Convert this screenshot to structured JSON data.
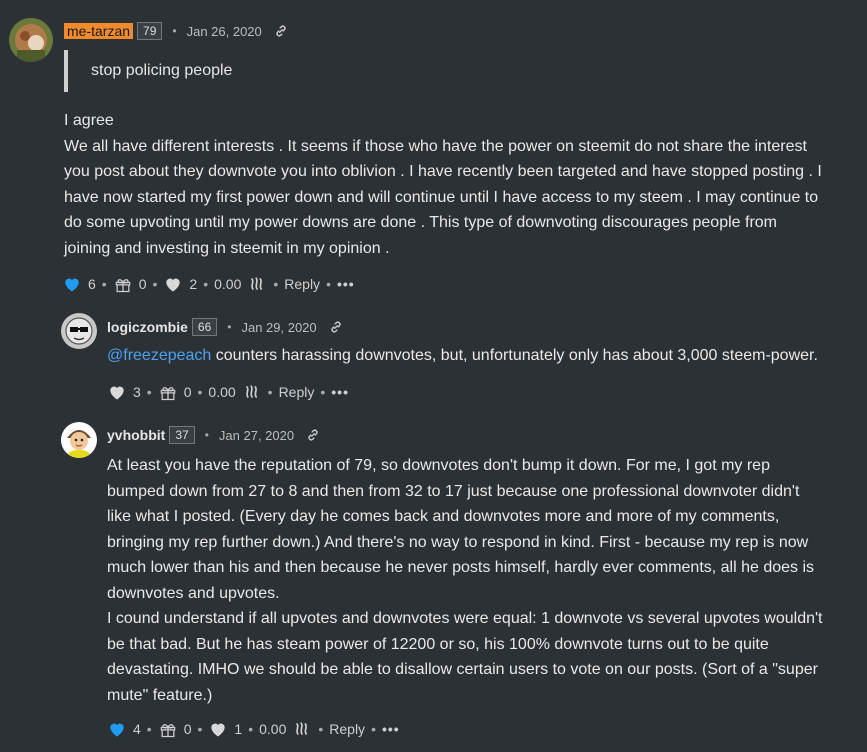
{
  "comments": [
    {
      "author": "me-tarzan",
      "reputation": "79",
      "date": "Jan 26, 2020",
      "quote": "stop policing people",
      "body_lines": [
        "I agree",
        "We all have different interests . It seems if those who have the power on steemit do not share the interest",
        "you post about they downvote you into oblivion . I have recently been targeted and have stopped posting . I",
        "have now started my first power down and will continue until I have access to my steem . I may continue to",
        "do some upvoting until my power downs are done . This type of downvoting discourages people from",
        "joining and investing in steemit in my opinion ."
      ],
      "upvotes": "6",
      "gifts": "0",
      "downvotes": "2",
      "payout": "0.00",
      "reply_label": "Reply",
      "more_label": "•••"
    },
    {
      "author": "logiczombie",
      "reputation": "66",
      "date": "Jan 29, 2020",
      "mention": "@freezepeach",
      "body_rest": " counters harassing downvotes, but, unfortunately only has about 3,000 steem-power.",
      "upvotes": "3",
      "gifts": "0",
      "payout": "0.00",
      "reply_label": "Reply",
      "more_label": "•••"
    },
    {
      "author": "yvhobbit",
      "reputation": "37",
      "date": "Jan 27, 2020",
      "body_lines": [
        "At least you have the reputation of 79, so downvotes don't bump it down. For me, I got my rep",
        "bumped down from 27 to 8 and then from 32 to 17 just because one professional downvoter didn't",
        "like what I posted. (Every day he comes back and downvotes more and more of my comments,",
        "bringing my rep further down.) And there's no way to respond in kind. First - because my rep is now",
        "much lower than his and then because he never posts himself, hardly ever comments, all he does is",
        "downvotes and upvotes.",
        "I cound understand if all upvotes and downvotes were equal: 1 downvote vs several upvotes wouldn't",
        "be that bad. But he has steam power of 12200 or so, his 100% downvote turns out to be quite",
        "devastating. IMHO we should be able to disallow certain users to vote on our posts. (Sort of a \"super",
        "mute\" feature.)"
      ],
      "upvotes": "4",
      "gifts": "0",
      "downvotes": "1",
      "payout": "0.00",
      "reply_label": "Reply",
      "more_label": "•••"
    }
  ],
  "separator": "•",
  "colors": {
    "background": "#2c3136",
    "heart_blue": "#1f9cf0",
    "heart_grey": "#d9d9d9",
    "mention": "#4ba2f2",
    "author_highlight": "#f08a2c"
  },
  "icons": [
    "heart-icon",
    "gift-icon",
    "broken-heart-icon",
    "steem-icon",
    "link-icon"
  ]
}
